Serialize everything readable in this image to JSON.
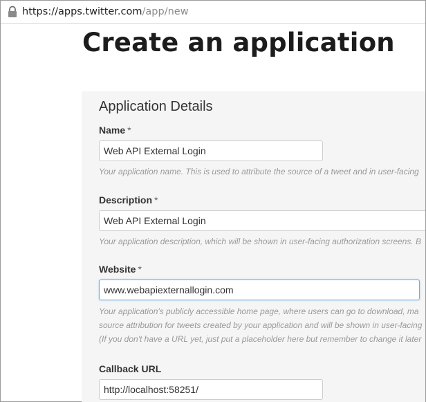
{
  "browser": {
    "url_host": "https://apps.twitter.com",
    "url_path": "/app/new",
    "lock_icon": "lock-icon"
  },
  "page": {
    "title": "Create an application"
  },
  "form": {
    "section_heading": "Application Details",
    "required_marker": "*",
    "name": {
      "label": "Name",
      "value": "Web API External Login",
      "help": "Your application name. This is used to attribute the source of a tweet and in user-facing"
    },
    "description": {
      "label": "Description",
      "value": "Web API External Login",
      "help": "Your application description, which will be shown in user-facing authorization screens. B"
    },
    "website": {
      "label": "Website",
      "value": "www.webapiexternallogin.com",
      "help_lines": [
        "Your application's publicly accessible home page, where users can go to download, ma",
        "source attribution for tweets created by your application and will be shown in user-facing",
        "(If you don't have a URL yet, just put a placeholder here but remember to change it later"
      ]
    },
    "callback_url": {
      "label": "Callback URL",
      "value": "http://localhost:58251/"
    }
  },
  "colors": {
    "panel_background": "#f5f5f5",
    "focus_border": "#7fa9d6",
    "help_text": "#9a9a9a"
  }
}
